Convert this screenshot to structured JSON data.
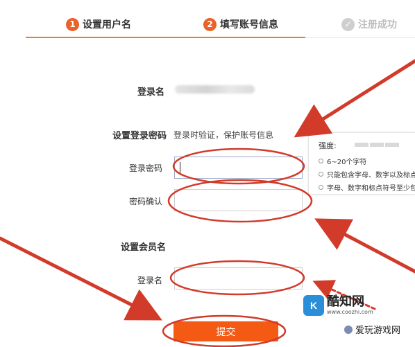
{
  "steps": [
    {
      "number": "1",
      "label": "设置用户名"
    },
    {
      "number": "2",
      "label": "填写账号信息"
    },
    {
      "label": "注册成功"
    }
  ],
  "form": {
    "username_label": "登录名",
    "password_section_title": "设置登录密码",
    "password_section_tip": "登录时验证，保护账号信息",
    "password_label": "登录密码",
    "password_confirm_label": "密码确认",
    "member_section_title": "设置会员名",
    "member_login_label": "登录名",
    "submit_label": "提交"
  },
  "strength_panel": {
    "label": "强度:",
    "rules": [
      "6~20个字符",
      "只能包含字母、数字以及标点",
      "字母、数字和标点符号至少包"
    ]
  },
  "watermarks": {
    "site_logo_text": "K",
    "site_name": "酷知网",
    "site_url": "www.coozhi.com",
    "secondary_name": "爱玩游戏网"
  },
  "colors": {
    "accent": "#f45a14",
    "step_active": "#e8622a",
    "annotation": "#d23a2a"
  }
}
